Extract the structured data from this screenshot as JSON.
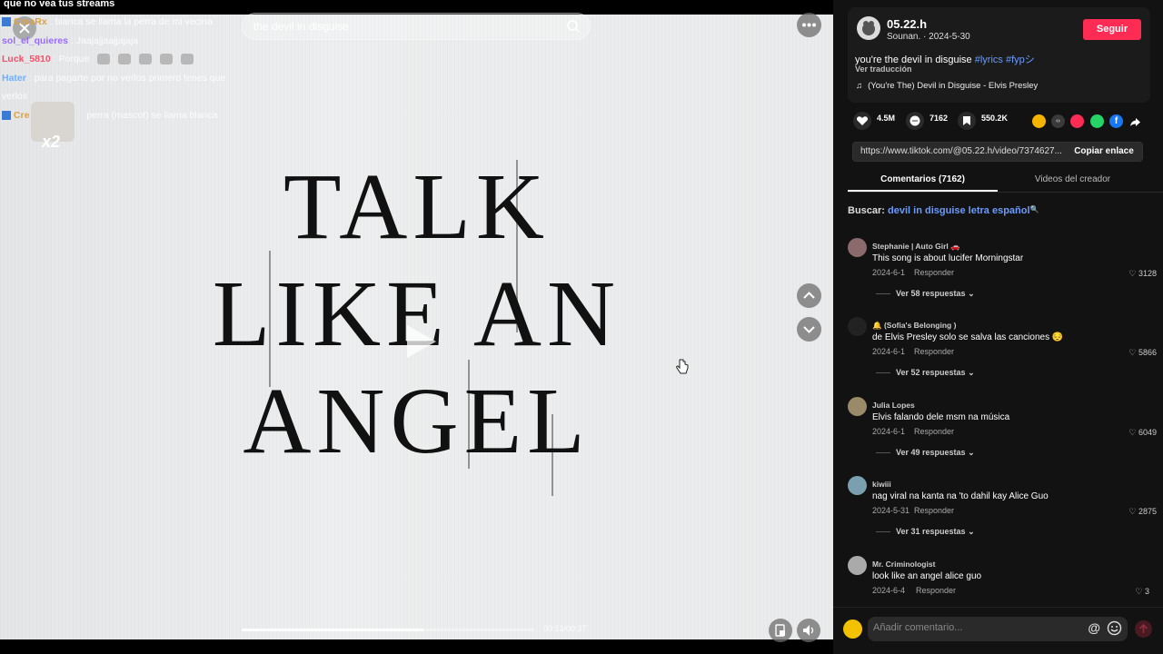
{
  "top_banner": "que no vea tus streams",
  "search": {
    "placeholder": "the devil in disguise"
  },
  "chat": [
    {
      "user": "CrssRx",
      "user_color": "#e0a040",
      "text": ": bianca se llama la perra de mi vecina"
    },
    {
      "user": "sol_el_quieres",
      "user_color": "#9a6bff",
      "text": ": Jaajajjaajjajaja"
    },
    {
      "user": "Luck_5810",
      "user_color": "#ff4d6a",
      "text": ": Porque"
    },
    {
      "user": "Hater",
      "user_color": "#6fb0ff",
      "text": ": para pagarte por no verlos primero tenes que"
    },
    {
      "user": "",
      "user_color": "#fff",
      "text": "verlos"
    },
    {
      "user": "Cre",
      "user_color": "#e0a040",
      "text": "perra (mascot) se llama blanca"
    }
  ],
  "sticker_multiplier": "x2",
  "video": {
    "lyric_lines": [
      "TALK",
      "LIKE AN",
      "ANGEL"
    ],
    "time": "00:13/00:37",
    "progress": 0.62
  },
  "author": {
    "name": "05.22.h",
    "subline": "Sounan. · 2024-5-30",
    "follow_label": "Seguir"
  },
  "description": {
    "text": "you're the devil in disguise ",
    "tags": "#lyrics #fyp",
    "suffix": "シ",
    "translate": "Ver traducción",
    "music": "(You're The) Devil in Disguise - Elvis Presley"
  },
  "stats": {
    "likes": "4.5M",
    "comments": "7162",
    "saves": "550.2K"
  },
  "share_colors": [
    "#f5b400",
    "#3a3a3a",
    "#fe2c55",
    "#25d366",
    "#1877f2"
  ],
  "link": {
    "url": "https://www.tiktok.com/@05.22.h/video/7374627...",
    "copy_label": "Copiar enlace"
  },
  "tabs": {
    "comments": "Comentarios (7162)",
    "creator": "Videos del creador"
  },
  "search_suggestion": {
    "label": "Buscar:",
    "query": "devil in disguise letra español"
  },
  "comments": [
    {
      "name": "Stephanie | Auto Girl 🚗",
      "text": "This song is about lucifer Morningstar",
      "date": "2024-6-1",
      "reply": "Responder",
      "likes": "3128",
      "replies": "Ver 58 respuestas",
      "avatar_color": "#8a6a6a"
    },
    {
      "name": "🔔 (Sofia's Belonging )",
      "text": "de Elvis Presley solo se salva las canciones 😔",
      "date": "2024-6-1",
      "reply": "Responder",
      "likes": "5866",
      "replies": "Ver 52 respuestas",
      "avatar_color": "#222222"
    },
    {
      "name": "Julia Lopes",
      "text": "Elvis falando dele msm na música",
      "date": "2024-6-1",
      "reply": "Responder",
      "likes": "6049",
      "replies": "Ver 49 respuestas",
      "avatar_color": "#9a8a6a"
    },
    {
      "name": "kiwiii",
      "text": "nag viral na kanta na 'to dahil kay Alice Guo",
      "date": "2024-5-31",
      "reply": "Responder",
      "likes": "2875",
      "replies": "Ver 31 respuestas",
      "avatar_color": "#7aa0b0"
    },
    {
      "name": "Mr. Criminologist",
      "text": "look like an angel alice guo",
      "date": "2024-6-4",
      "reply": "Responder",
      "likes": "3",
      "replies": "",
      "avatar_color": "#aaaaaa"
    }
  ],
  "comment_input": {
    "placeholder": "Añadir comentario...",
    "at": "@"
  }
}
